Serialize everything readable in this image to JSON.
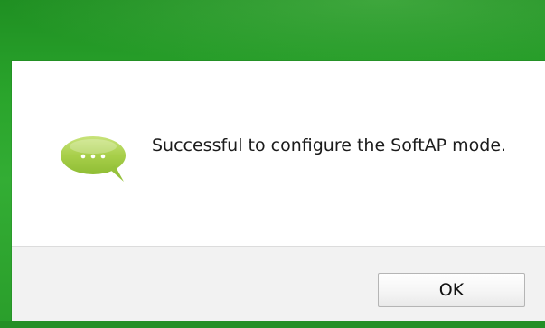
{
  "dialog": {
    "message": "Successful to configure the SoftAP mode.",
    "icon": "speech-bubble-icon",
    "ok_label": "OK"
  },
  "colors": {
    "background_green": "#2aa52c",
    "bubble_green": "#a8cf4a",
    "dialog_white": "#ffffff",
    "footer_gray": "#f2f2f2"
  }
}
